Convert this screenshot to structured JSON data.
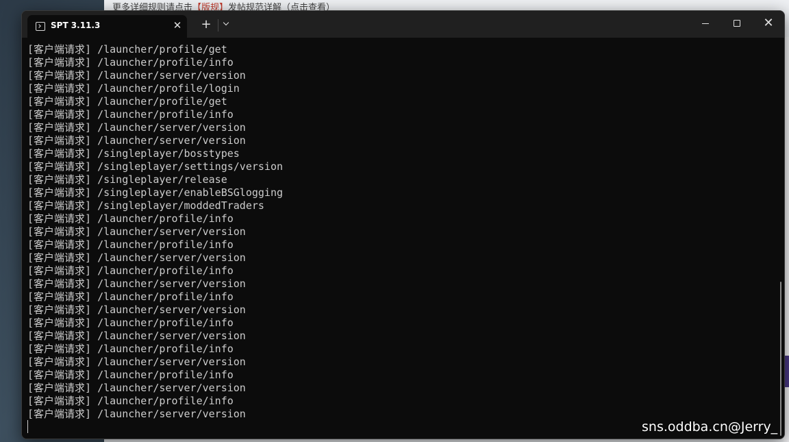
{
  "background": {
    "top_text_prefix": "更多详细规则请点击",
    "top_text_highlight": "【版规】",
    "top_text_suffix": "发帖规范详解（点击查看）"
  },
  "window": {
    "tab_title": "SPT 3.11.3",
    "tab_close": "✕",
    "new_tab": "+",
    "close": "✕"
  },
  "terminal": {
    "prefix": "[客户端请求]",
    "lines": [
      "/launcher/profile/get",
      "/launcher/profile/info",
      "/launcher/server/version",
      "/launcher/profile/login",
      "/launcher/profile/get",
      "/launcher/profile/info",
      "/launcher/server/version",
      "/launcher/server/version",
      "/singleplayer/bosstypes",
      "/singleplayer/settings/version",
      "/singleplayer/release",
      "/singleplayer/enableBSGlogging",
      "/singleplayer/moddedTraders",
      "/launcher/profile/info",
      "/launcher/server/version",
      "/launcher/profile/info",
      "/launcher/server/version",
      "/launcher/profile/info",
      "/launcher/server/version",
      "/launcher/profile/info",
      "/launcher/server/version",
      "/launcher/profile/info",
      "/launcher/server/version",
      "/launcher/profile/info",
      "/launcher/server/version",
      "/launcher/profile/info",
      "/launcher/server/version",
      "/launcher/profile/info",
      "/launcher/server/version"
    ]
  },
  "watermark": "sns.oddba.cn@Jerry_"
}
